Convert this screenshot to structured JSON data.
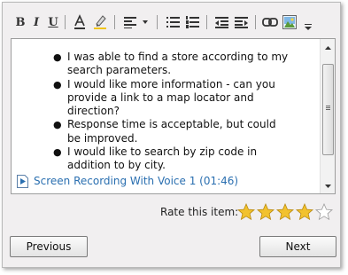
{
  "toolbar": {
    "bold_label": "B",
    "italic_label": "I",
    "underline_label": "U",
    "buttons": [
      "bold",
      "italic",
      "underline",
      "font-color-icon",
      "highlight-icon",
      "align-left-icon",
      "dropdown-arrow-icon",
      "bullet-list-icon",
      "numbered-list-icon",
      "outdent-icon",
      "indent-icon",
      "link-icon",
      "image-icon",
      "more-icon"
    ]
  },
  "editor": {
    "bullets": [
      "I was able to find a store according to my search parameters.",
      "I would like more information - can you provide a link to a map locator and direction?",
      "Response time is acceptable, but could be improved.",
      "I would like to search by zip code in addition to by city."
    ],
    "bullet_char": "●",
    "recording_label": "Screen Recording With Voice 1 (01:46)"
  },
  "rating": {
    "label": "Rate this item:",
    "value": 4,
    "max": 5
  },
  "nav": {
    "previous_label": "Previous",
    "next_label": "Next"
  },
  "colors": {
    "link": "#2a6fb0",
    "star_fill": "#f2c22e",
    "panel_bg": "#f1eff0"
  }
}
